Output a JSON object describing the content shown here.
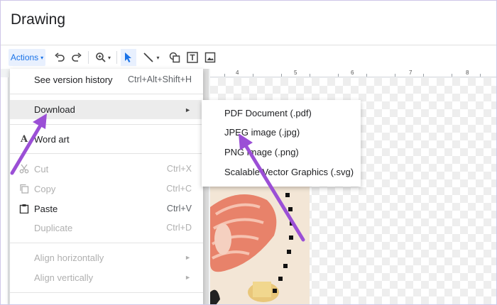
{
  "app": {
    "title": "Drawing"
  },
  "toolbar": {
    "actions_label": "Actions",
    "actions_caret": "▾",
    "undo_icon": "undo-icon",
    "redo_icon": "redo-icon",
    "zoom_icon": "zoom-icon",
    "select_icon": "pointer-icon",
    "line_icon": "line-icon",
    "shape_icon": "shape-icon",
    "textbox_icon": "textbox-icon",
    "image_icon": "image-icon"
  },
  "ruler": {
    "labels": [
      "4",
      "5",
      "6",
      "7",
      "8"
    ]
  },
  "menu": {
    "items": [
      {
        "label": "See version history",
        "shortcut": "Ctrl+Alt+Shift+H"
      },
      {
        "label": "Download",
        "arrow": "►"
      },
      {
        "label": "Word art",
        "icon": "A"
      },
      {
        "label": "Cut",
        "shortcut": "Ctrl+X"
      },
      {
        "label": "Copy",
        "shortcut": "Ctrl+C"
      },
      {
        "label": "Paste",
        "shortcut": "Ctrl+V"
      },
      {
        "label": "Duplicate",
        "shortcut": "Ctrl+D"
      },
      {
        "label": "Align horizontally",
        "arrow": "►"
      },
      {
        "label": "Align vertically",
        "arrow": "►"
      }
    ]
  },
  "submenu": {
    "items": [
      {
        "label": "PDF Document (.pdf)"
      },
      {
        "label": "JPEG image (.jpg)"
      },
      {
        "label": "PNG image (.png)"
      },
      {
        "label": "Scalable Vector Graphics (.svg)"
      }
    ]
  },
  "colors": {
    "accent": "#1a73e8",
    "annotation_arrow": "#9b4fd6",
    "highlight": "#ececec"
  }
}
